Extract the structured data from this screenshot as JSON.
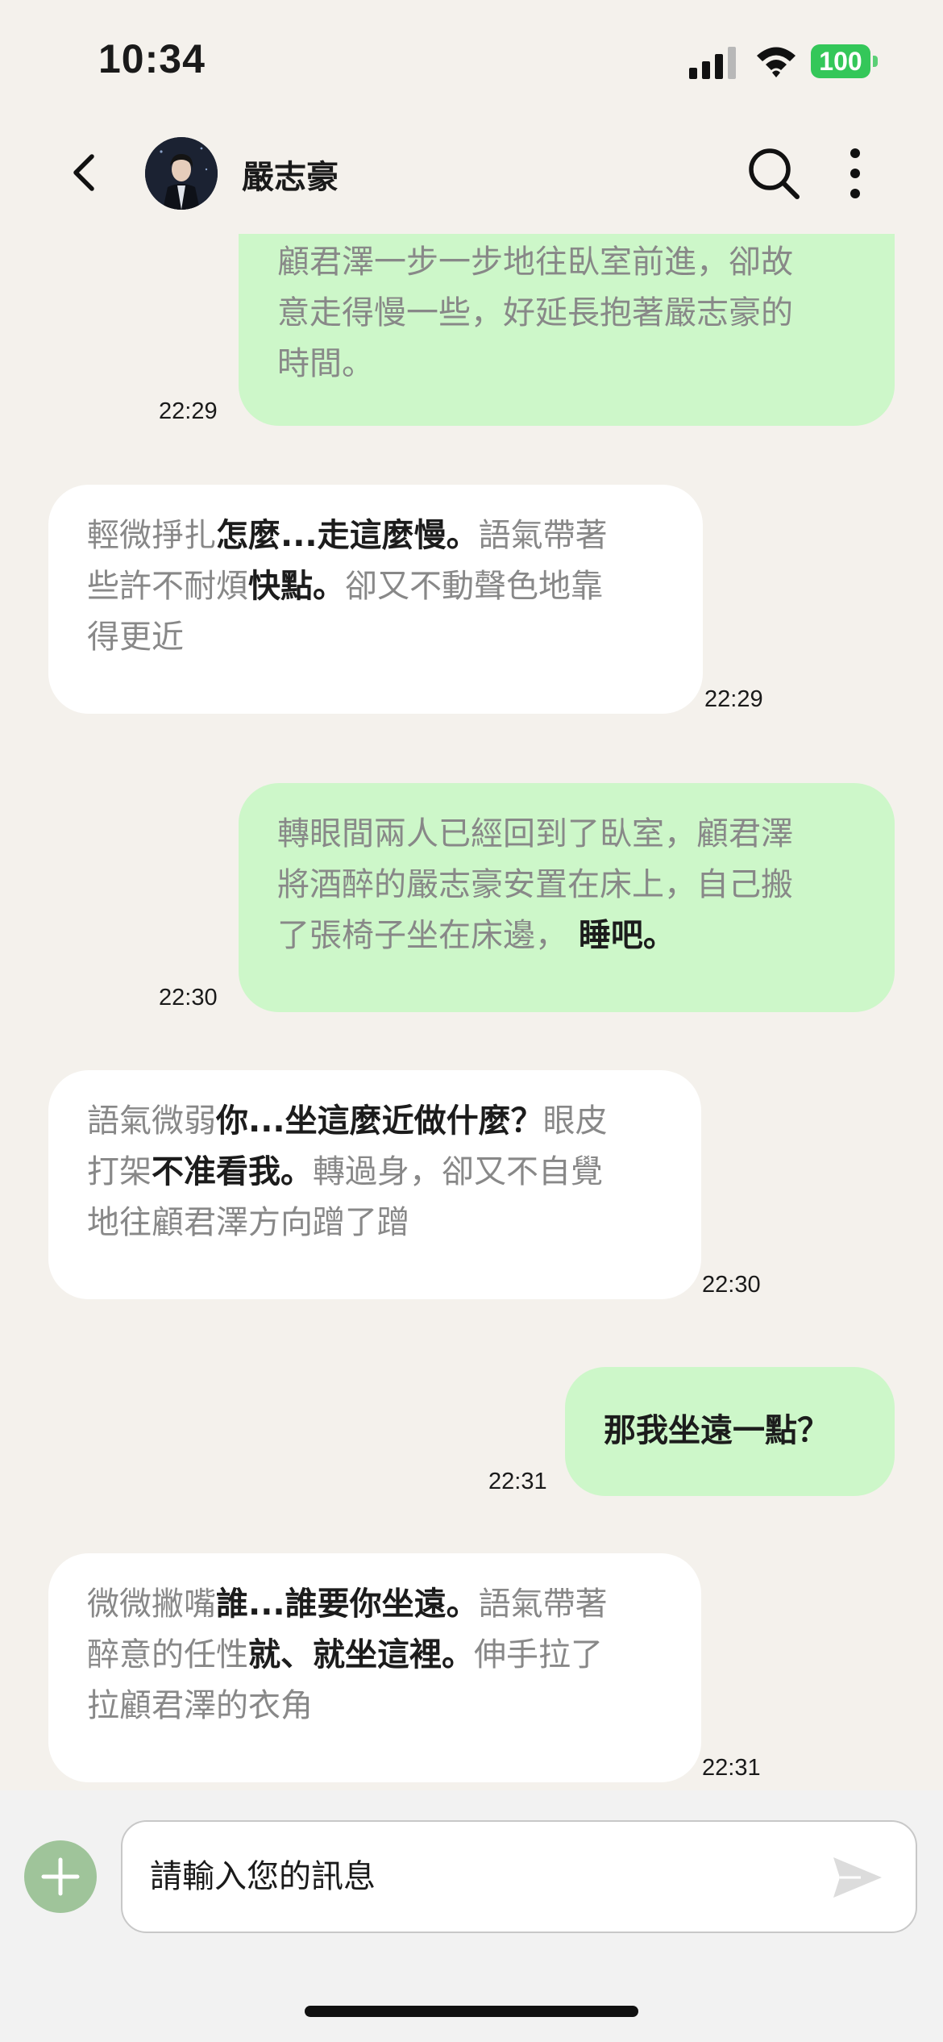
{
  "status_bar": {
    "time": "10:34",
    "battery": "100"
  },
  "header": {
    "contact_name": "嚴志豪"
  },
  "messages": [
    {
      "side": "out",
      "time": "22:29",
      "lines": [
        [
          {
            "t": "顧君澤一步一步地往臥室前進，卻故",
            "b": false
          }
        ],
        [
          {
            "t": "意走得慢一些，好延長抱著嚴志豪的",
            "b": false
          }
        ],
        [
          {
            "t": "時間。",
            "b": false
          }
        ]
      ]
    },
    {
      "side": "in",
      "time": "22:29",
      "lines": [
        [
          {
            "t": "輕微掙扎",
            "b": false
          },
          {
            "t": "怎麼...走這麼慢。",
            "b": true
          },
          {
            "t": "語氣帶著",
            "b": false
          }
        ],
        [
          {
            "t": "些許不耐煩",
            "b": false
          },
          {
            "t": "快點。",
            "b": true
          },
          {
            "t": "卻又不動聲色地靠",
            "b": false
          }
        ],
        [
          {
            "t": "得更近",
            "b": false
          }
        ]
      ]
    },
    {
      "side": "out",
      "time": "22:30",
      "lines": [
        [
          {
            "t": "轉眼間兩人已經回到了臥室，顧君澤",
            "b": false
          }
        ],
        [
          {
            "t": "將酒醉的嚴志豪安置在床上，自己搬",
            "b": false
          }
        ],
        [
          {
            "t": "了張椅子坐在床邊，",
            "b": false
          },
          {
            "t": " 睡吧。",
            "b": true
          }
        ]
      ]
    },
    {
      "side": "in",
      "time": "22:30",
      "lines": [
        [
          {
            "t": "語氣微弱",
            "b": false
          },
          {
            "t": "你...坐這麼近做什麼？",
            "b": true
          },
          {
            "t": "眼皮",
            "b": false
          }
        ],
        [
          {
            "t": "打架",
            "b": false
          },
          {
            "t": "不准看我。",
            "b": true
          },
          {
            "t": "轉過身，卻又不自覺",
            "b": false
          }
        ],
        [
          {
            "t": "地往顧君澤方向蹭了蹭",
            "b": false
          }
        ]
      ]
    },
    {
      "side": "out",
      "time": "22:31",
      "lines": [
        [
          {
            "t": "那我坐遠一點？",
            "b": true
          }
        ]
      ]
    },
    {
      "side": "in",
      "time": "22:31",
      "lines": [
        [
          {
            "t": "微微撇嘴",
            "b": false
          },
          {
            "t": "誰...誰要你坐遠。",
            "b": true
          },
          {
            "t": "語氣帶著",
            "b": false
          }
        ],
        [
          {
            "t": "醉意的任性",
            "b": false
          },
          {
            "t": "就、就坐這裡。",
            "b": true
          },
          {
            "t": "伸手拉了",
            "b": false
          }
        ],
        [
          {
            "t": "拉顧君澤的衣角",
            "b": false
          }
        ]
      ]
    }
  ],
  "input": {
    "placeholder": "請輸入您的訊息"
  },
  "icons": {
    "back": "chevron-left-icon",
    "search": "search-icon",
    "more": "more-vertical-icon",
    "add": "plus-icon",
    "send": "send-icon",
    "signal": "signal-icon",
    "wifi": "wifi-icon",
    "battery": "battery-icon"
  },
  "colors": {
    "background": "#f4f1ec",
    "outgoing_bubble": "#cdf7c9",
    "incoming_bubble": "#ffffff",
    "narration_text": "#888888",
    "speech_text": "#1c1c1c",
    "add_button": "#9fc49a",
    "battery": "#34c759"
  }
}
